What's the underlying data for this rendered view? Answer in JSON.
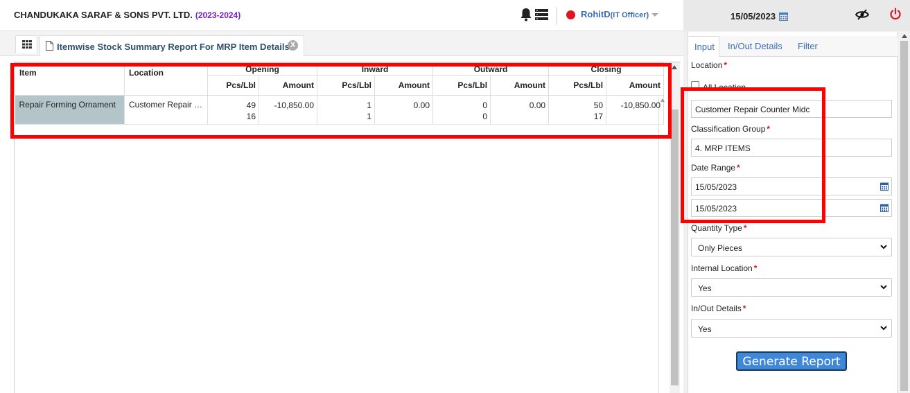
{
  "header": {
    "company": "CHANDUKAKA SARAF & SONS PVT. LTD.",
    "year": "(2023-2024)",
    "user_name": "RohitD",
    "user_role": "(IT Officer)",
    "date": "15/05/2023"
  },
  "tab": {
    "title": "Itemwise Stock Summary Report For MRP Item Details",
    "close": "X"
  },
  "grid": {
    "columns": {
      "item": "Item",
      "location": "Location",
      "groups": [
        "Opening",
        "Inward",
        "Outward",
        "Closing"
      ],
      "pcs": "Pcs/Lbl",
      "amount": "Amount"
    },
    "rows": [
      {
        "item": "Repair Forming Ornament",
        "location": "Customer Repair Counter Midc",
        "opening_pcs": "49",
        "opening_lbl": "16",
        "opening_amount": "-10,850.00",
        "inward_pcs": "1",
        "inward_lbl": "1",
        "inward_amount": "0.00",
        "outward_pcs": "0",
        "outward_lbl": "0",
        "outward_amount": "0.00",
        "closing_pcs": "50",
        "closing_lbl": "17",
        "closing_amount": "-10,850.00"
      }
    ]
  },
  "panel": {
    "tabs": [
      "Input",
      "In/Out Details",
      "Filter"
    ],
    "location_label": "Location",
    "all_location_label": "All Location",
    "location_value": "Customer Repair Counter Midc",
    "classification_label": "Classification Group",
    "classification_value": "4. MRP ITEMS",
    "date_range_label": "Date Range",
    "date_from": "15/05/2023",
    "date_to": "15/05/2023",
    "quantity_type_label": "Quantity Type",
    "quantity_type_value": "Only Pieces",
    "internal_location_label": "Internal Location",
    "internal_location_value": "Yes",
    "inout_details_label": "In/Out Details",
    "inout_details_value": "Yes",
    "generate_button": "Generate Report",
    "required_mark": "*"
  },
  "colors": {
    "highlight": "#ff0000",
    "brand_blue": "#3b6db3",
    "year_purple": "#7a1fc9",
    "status_red": "#e0141e",
    "button_blue": "#3f88d7"
  }
}
